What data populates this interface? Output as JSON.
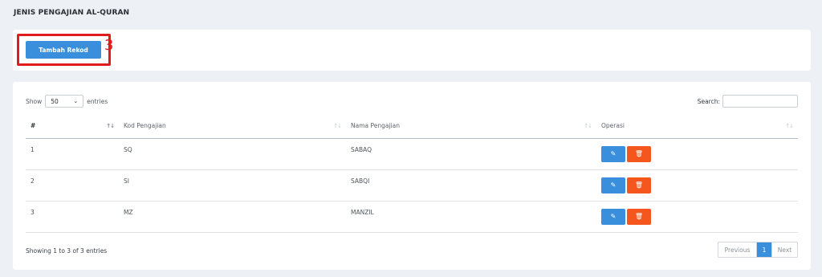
{
  "page": {
    "title": "JENIS PENGAJIAN AL-QURAN"
  },
  "toolbar": {
    "add_label": "Tambah Rekod",
    "annotation_number": "3"
  },
  "table_controls": {
    "show_label": "Show",
    "entries_value": "50",
    "entries_label": "entries",
    "search_label": "Search:",
    "search_value": ""
  },
  "table": {
    "columns": [
      "#",
      "Kod Pengajian",
      "Nama Pengajian",
      "Operasi"
    ],
    "rows": [
      {
        "num": "1",
        "kod": "SQ",
        "nama": "SABAQ"
      },
      {
        "num": "2",
        "kod": "SI",
        "nama": "SABQI"
      },
      {
        "num": "3",
        "kod": "MZ",
        "nama": "MANZIL"
      }
    ]
  },
  "footer": {
    "info": "Showing 1 to 3 of 3 entries",
    "prev_label": "Previous",
    "current_page": "1",
    "next_label": "Next"
  },
  "icons": {
    "edit": "edit-icon",
    "delete": "trash-icon",
    "sort": "sort-icon",
    "chevron": "chevron-down-icon"
  },
  "colors": {
    "primary": "#3a8fdc",
    "danger": "#f4561d",
    "highlight": "#e11c1c",
    "background": "#edf1f5"
  }
}
